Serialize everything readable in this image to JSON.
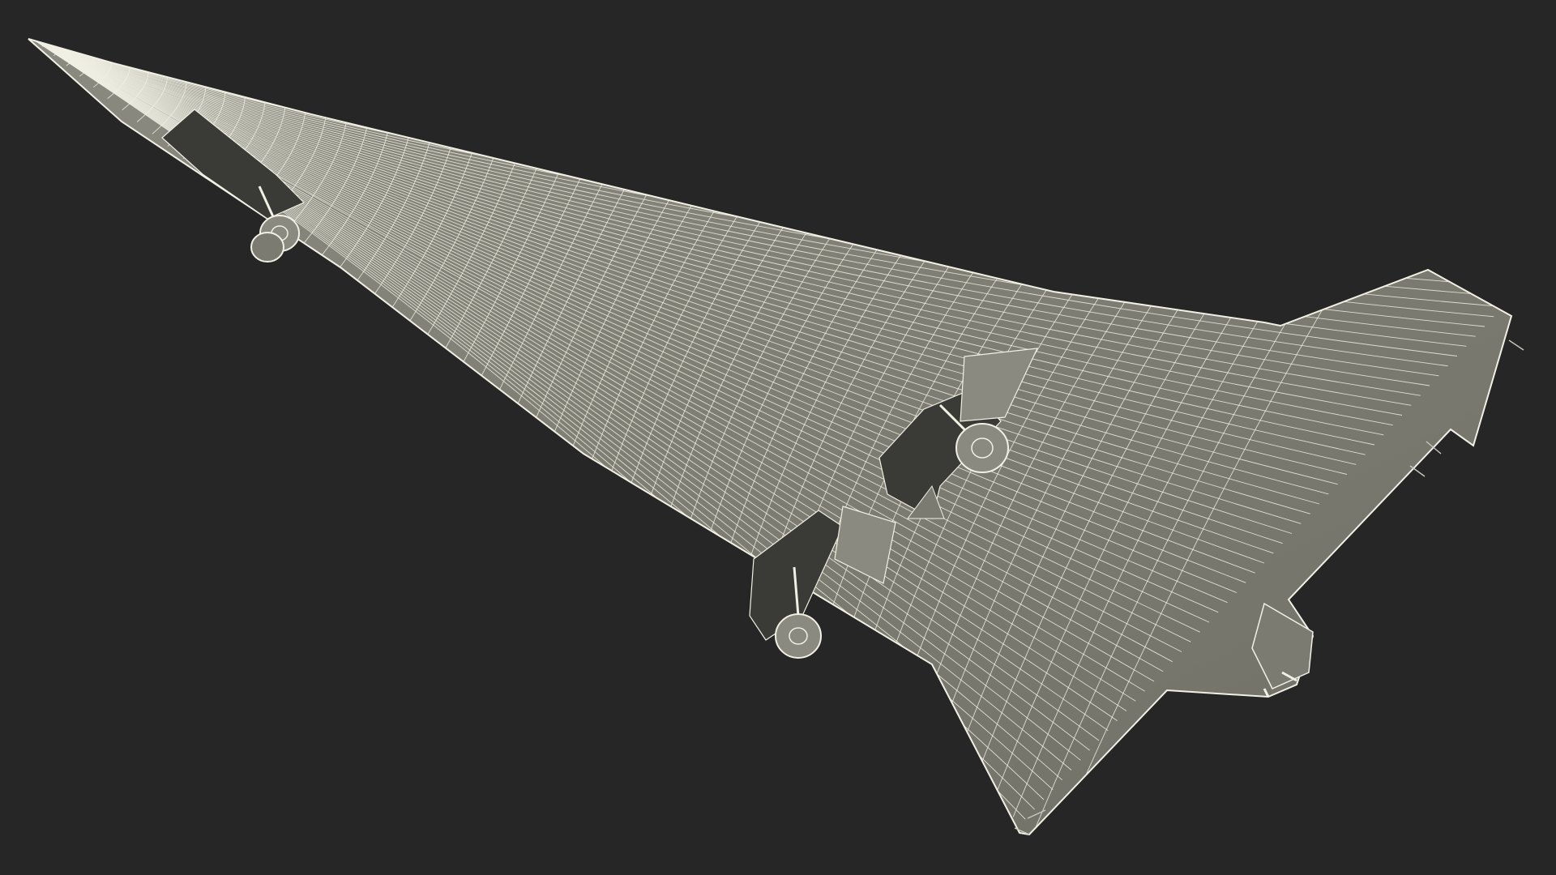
{
  "scene": {
    "subject": "wireframe-delta-wing-spaceplane",
    "background_color": "#262626",
    "surface_color": "#7b7b70",
    "wire_color": "#f1f0e4",
    "shadow_color": "#3b3b37"
  }
}
